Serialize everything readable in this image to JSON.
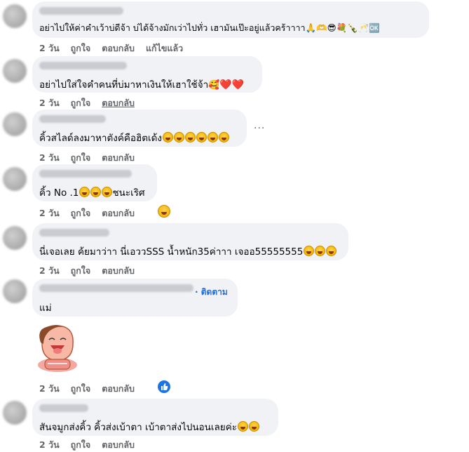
{
  "comments": [
    {
      "text": "อย่าไปให้ค่าคำเว้าบ่ดีจ้า บ่ได้จ้างมักเว่าไปทั่ว เฮามันเป๊ะอยู่แล้วคร้าาาา🙏🫶😎💐🍾🥂🆗",
      "actions": {
        "time": "2 วัน",
        "like": "ถูกใจ",
        "reply": "ตอบกลับ",
        "edited": "แก้ไขแล้ว"
      }
    },
    {
      "text": "อย่าไปใส่ใจคำคนที่บ่มาหาเงินให้เฮาใช้จ้า",
      "emoji": [
        "🥰",
        "❤️",
        "❤️"
      ],
      "actions": {
        "time": "2 วัน",
        "like": "ถูกใจ",
        "reply": "ตอบกลับ"
      }
    },
    {
      "text": "คิ้วสไลด์ลงมาหาตังค์คือฮิตเด้ง",
      "emoji": [
        "🤣",
        "🤣",
        "🤣",
        "🤣",
        "🤣",
        "🤣"
      ],
      "more": "···",
      "actions": {
        "time": "2 วัน",
        "like": "ถูกใจ",
        "reply": "ตอบกลับ"
      }
    },
    {
      "text_before": "คิ้ว No .1",
      "emoji": [
        "🤣",
        "🤣",
        "🤣"
      ],
      "text_after": "ชนะเริศ",
      "actions": {
        "time": "2 วัน",
        "like": "ถูกใจ",
        "reply": "ตอบกลับ"
      },
      "reaction": "😆"
    },
    {
      "text": "นี่เจอเลย ค้ยมาว่าา นี่เอววSSS น้ำหนัก35ค่าาา เจออ55555555",
      "emoji": [
        "😂",
        "😂",
        "😂"
      ],
      "actions": {
        "time": "2 วัน",
        "like": "ถูกใจ",
        "reply": "ตอบกลับ"
      }
    },
    {
      "follow": "· ติดตาม",
      "text": "แม่",
      "actions": {
        "time": "2 วัน",
        "like": "ถูกใจ",
        "reply": "ตอบกลับ"
      },
      "reaction": "👍"
    },
    {
      "text": "สันจมูกส่งคิ้ว คิ้วส่งเบ้าตา เบ้าตาส่งไปนอนเลยค่ะ",
      "emoji": [
        "🤣",
        "🤣"
      ],
      "actions": {
        "time": "2 วัน",
        "like": "ถูกใจ",
        "reply": "ตอบกลับ"
      }
    }
  ],
  "colors": {
    "bubble": "#f0f2f5",
    "action_text": "#65676b",
    "link": "#216fdb"
  }
}
